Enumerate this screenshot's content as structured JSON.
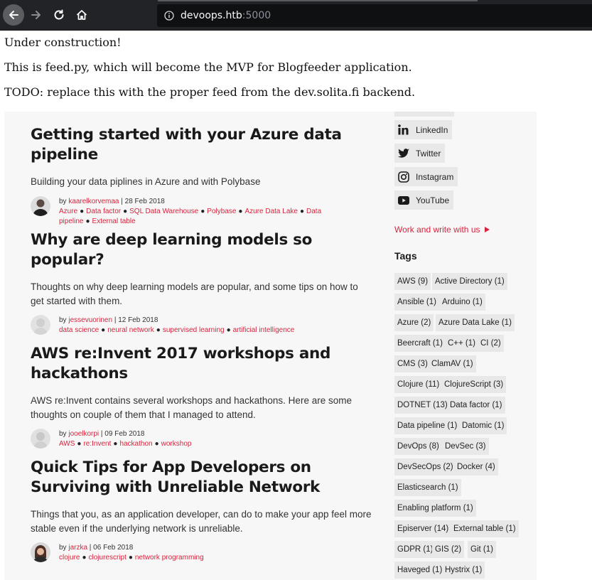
{
  "browser": {
    "url_host": "devoops.htb",
    "url_port": ":5000"
  },
  "page": {
    "line1": "Under construction!",
    "line2": "This is feed.py, which will become the MVP for Blogfeeder application.",
    "line3": "TODO: replace this with the proper feed from the dev.solita.fi backend."
  },
  "posts": [
    {
      "title": "Getting started with your Azure data pipeline",
      "summary": "Building your data piplines in Azure and with Polybase",
      "by": "by ",
      "author": "kaarelkorvemaa",
      "date": " | 28 Feb 2018",
      "tags": [
        "Azure",
        "Data factor",
        "SQL Data Warehouse",
        "Polybase",
        "Azure Data Lake",
        "Data pipeline",
        "External table"
      ]
    },
    {
      "title": "Why are deep learning models so popular?",
      "summary": "Thoughts on why deep learning models are popular, and some tips on how to get started with them.",
      "by": "by ",
      "author": "jessevuorinen",
      "date": " | 12 Feb 2018",
      "tags": [
        "data science",
        "neural network",
        "supervised learning",
        "artificial intelligence"
      ]
    },
    {
      "title": "AWS re:Invent 2017 workshops and hackathons",
      "summary": "AWS re:Invent contains several workshops and hackathons. Here are some thoughts on couple of them that I managed to attend.",
      "by": "by ",
      "author": "jooelkorpi",
      "date": " | 09 Feb 2018",
      "tags": [
        "AWS",
        "re:Invent",
        "hackathon",
        "workshop"
      ]
    },
    {
      "title": "Quick Tips for App Developers on Surviving with Unreliable Network",
      "summary": "Things that you, as an application developer, can do to make your app feel more stable even if the underlying network is unreliable.",
      "by": "by ",
      "author": "jarzka",
      "date": " | 06 Feb 2018",
      "tags": [
        "clojure",
        "clojurescript",
        "network programming"
      ]
    }
  ],
  "sidebar": {
    "social": [
      {
        "label": "LinkedIn",
        "icon": "linkedin-icon"
      },
      {
        "label": "Twitter",
        "icon": "twitter-icon"
      },
      {
        "label": "Instagram",
        "icon": "instagram-icon"
      },
      {
        "label": "YouTube",
        "icon": "youtube-icon"
      }
    ],
    "work_write": "Work and write with us",
    "tags_heading": "Tags",
    "tags": [
      "AWS (9)",
      "Active Directory (1)",
      "Ansible (1)",
      "Arduino (1)",
      "Azure (2)",
      "Azure Data Lake (1)",
      "Beercraft (1)",
      "C++ (1)",
      "CI (2)",
      "CMS (3)",
      "ClamAV (1)",
      "Clojure (11)",
      "ClojureScript (3)",
      "DOTNET (13)",
      "Data factor (1)",
      "Data pipeline (1)",
      "Datomic (1)",
      "DevOps (8)",
      "DevSec (3)",
      "DevSecOps (2)",
      "Docker (4)",
      "Elasticsearch (1)",
      "Enabling platform (1)",
      "Episerver (14)",
      "External table (1)",
      "GDPR (1)",
      "GIS (2)",
      "Git (1)",
      "Haveged (1)",
      "Hystrix (1)"
    ]
  },
  "colors": {
    "accent": "#d8243d",
    "chrome": "#222326",
    "blog_bg": "#f7f7f7",
    "tag_bg": "#e8e8e8"
  }
}
